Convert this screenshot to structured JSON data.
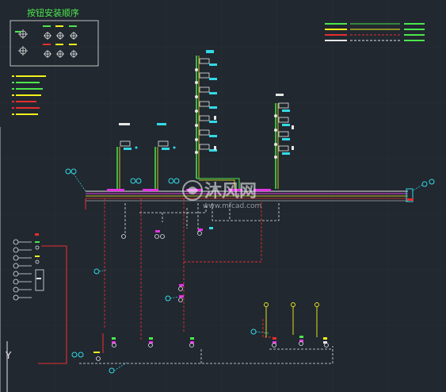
{
  "colors": {
    "background": "#212830",
    "green": "#4de64d",
    "yellow": "#f2f21a",
    "red": "#e62e2e",
    "white": "#e6e6e6",
    "cyan": "#33d9e6",
    "magenta": "#e633e6",
    "grid": "#2c343d"
  },
  "legend_box": {
    "title": "按钮安装顺序"
  },
  "watermark": {
    "text": "沐风网",
    "url": "www.mfcad.com"
  },
  "axis_marker": {
    "label": "Y"
  },
  "icons": {
    "ucs": "ucs-axis-icon",
    "valve": "valve-symbol-icon",
    "gauge": "gauge-circle-icon",
    "logo": "watermark-logo-icon"
  }
}
